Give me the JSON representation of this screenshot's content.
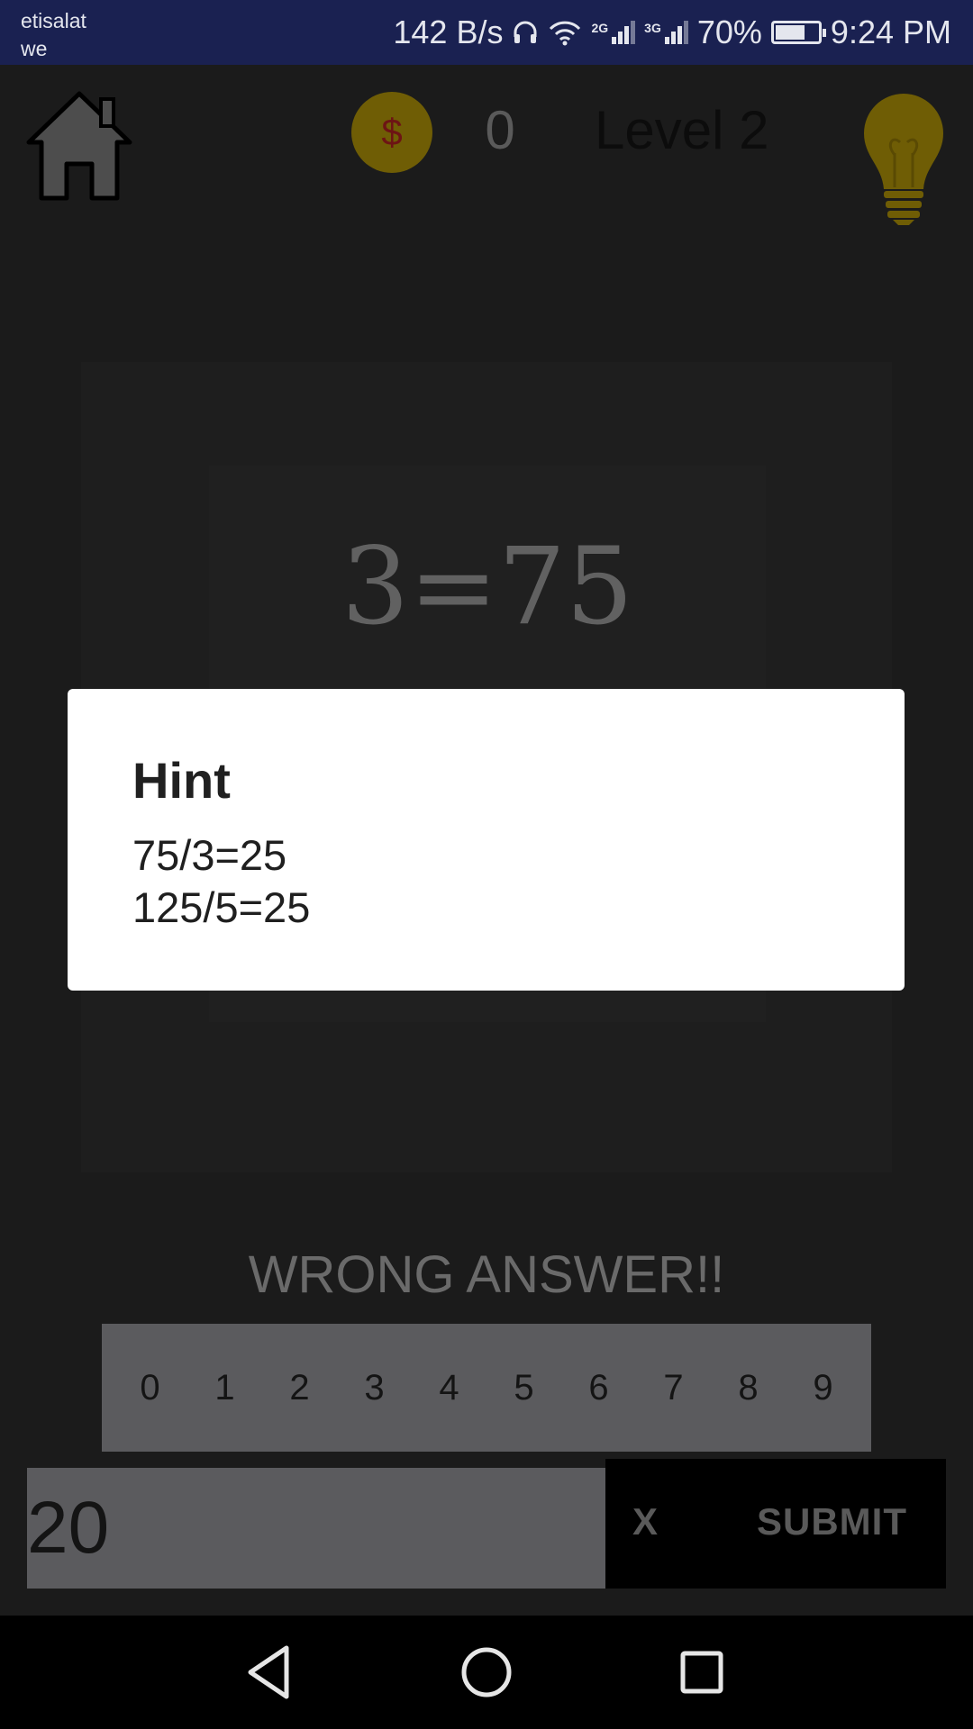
{
  "status_bar": {
    "carrier_line1": "etisalat",
    "carrier_line2": "we",
    "network_speed": "142 B/s",
    "battery_percent": "70%",
    "battery_level": 0.7,
    "time": "9:24 PM",
    "signal_1_tag": "2G",
    "signal_2_tag": "3G"
  },
  "header": {
    "coin_symbol": "$",
    "coin_count": "0",
    "level": "Level 2"
  },
  "puzzle": {
    "text": "3=75"
  },
  "result": {
    "message": "WRONG ANSWER!!"
  },
  "keypad": {
    "keys": [
      "0",
      "1",
      "2",
      "3",
      "4",
      "5",
      "6",
      "7",
      "8",
      "9"
    ]
  },
  "answer": {
    "value": "20",
    "clear_label": "X",
    "submit_label": "SUBMIT"
  },
  "dialog": {
    "title": "Hint",
    "line1": "75/3=25",
    "line2": "125/5=25"
  },
  "colors": {
    "status_bar": "#1a2151",
    "dim_background": "#1b1b1b",
    "coin": "#6f5d05",
    "bulb": "#6f5d05"
  }
}
